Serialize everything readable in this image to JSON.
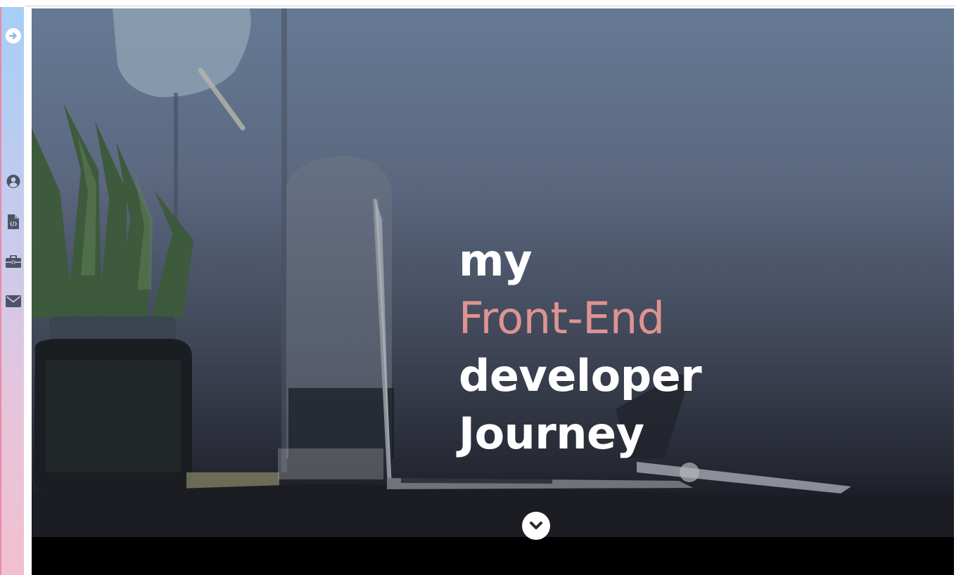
{
  "sidebar": {
    "toggle_icon": "arrow-right-circle-icon",
    "items": [
      {
        "icon": "user-circle-icon",
        "name": "about"
      },
      {
        "icon": "code-file-icon",
        "name": "skills"
      },
      {
        "icon": "briefcase-icon",
        "name": "portfolio"
      },
      {
        "icon": "envelope-icon",
        "name": "contact"
      }
    ]
  },
  "hero": {
    "line1": "my",
    "line2": "Front-End",
    "line3": "developer",
    "line4": "Journey",
    "scroll_icon": "chevron-down-icon"
  },
  "colors": {
    "accent": "#dd9491",
    "sidebar_top": "#a6cef6",
    "sidebar_bottom": "#f1bfcf",
    "icon": "#4a5566"
  }
}
